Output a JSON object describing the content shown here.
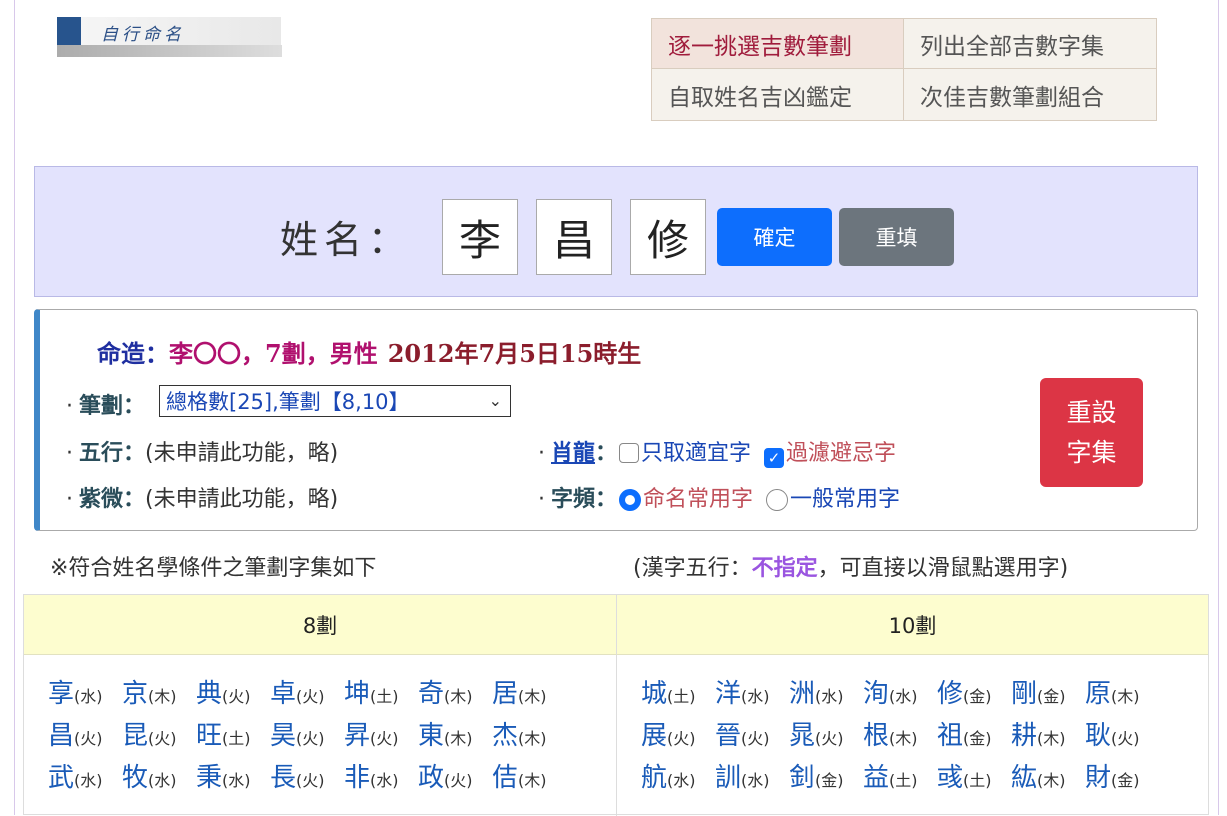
{
  "logo": {
    "text": "自行命名"
  },
  "menu": [
    {
      "label": "逐一挑選吉數筆劃",
      "active": true
    },
    {
      "label": "列出全部吉數字集",
      "active": false
    },
    {
      "label": "自取姓名吉凶鑑定",
      "active": false
    },
    {
      "label": "次佳吉數筆劃組合",
      "active": false
    }
  ],
  "name_form": {
    "label": "姓名：",
    "chars": [
      "李",
      "昌",
      "修"
    ],
    "confirm_label": "確定",
    "reset_label": "重填"
  },
  "fate": {
    "prefix": "命造：",
    "main": "李〇〇，7劃，男性",
    "birth": "2012年7月5日15時生"
  },
  "options": {
    "strokes_label": "筆劃：",
    "strokes_value": "總格數[25],筆劃【8,10】",
    "wuxing_label": "五行：",
    "wuxing_value": "(未申請此功能，略)",
    "ziwei_label": "紫微：",
    "ziwei_value": "(未申請此功能，略)",
    "zodiac_label": "肖龍",
    "zodiac_colon": "：",
    "only_suitable": "只取適宜字",
    "only_suitable_checked": false,
    "filter_taboo": "過濾避忌字",
    "filter_taboo_checked": true,
    "freq_label": "字頻：",
    "freq_common_name": "命名常用字",
    "freq_common_name_selected": true,
    "freq_general": "一般常用字",
    "freq_general_selected": false,
    "reset_set_line1": "重設",
    "reset_set_line2": "字集"
  },
  "notes": {
    "left": "※符合姓名學條件之筆劃字集如下",
    "right_prefix": "(漢字五行：",
    "right_em": "不指定",
    "right_suffix": "，可直接以滑鼠點選用字)"
  },
  "table": {
    "col1_header": "8劃",
    "col2_header": "10劃",
    "col1_chars": [
      [
        "享",
        "水"
      ],
      [
        "京",
        "木"
      ],
      [
        "典",
        "火"
      ],
      [
        "卓",
        "火"
      ],
      [
        "坤",
        "土"
      ],
      [
        "奇",
        "木"
      ],
      [
        "居",
        "木"
      ],
      [
        "昌",
        "火"
      ],
      [
        "昆",
        "火"
      ],
      [
        "旺",
        "土"
      ],
      [
        "昊",
        "火"
      ],
      [
        "昇",
        "火"
      ],
      [
        "東",
        "木"
      ],
      [
        "杰",
        "木"
      ],
      [
        "武",
        "水"
      ],
      [
        "牧",
        "水"
      ],
      [
        "秉",
        "水"
      ],
      [
        "長",
        "火"
      ],
      [
        "非",
        "水"
      ],
      [
        "政",
        "火"
      ],
      [
        "佶",
        "木"
      ]
    ],
    "col2_chars": [
      [
        "城",
        "土"
      ],
      [
        "洋",
        "水"
      ],
      [
        "洲",
        "水"
      ],
      [
        "洵",
        "水"
      ],
      [
        "修",
        "金"
      ],
      [
        "剛",
        "金"
      ],
      [
        "原",
        "木"
      ],
      [
        "展",
        "火"
      ],
      [
        "晉",
        "火"
      ],
      [
        "晁",
        "火"
      ],
      [
        "根",
        "木"
      ],
      [
        "祖",
        "金"
      ],
      [
        "耕",
        "木"
      ],
      [
        "耿",
        "火"
      ],
      [
        "航",
        "水"
      ],
      [
        "訓",
        "水"
      ],
      [
        "釗",
        "金"
      ],
      [
        "益",
        "土"
      ],
      [
        "彧",
        "土"
      ],
      [
        "紘",
        "木"
      ],
      [
        "財",
        "金"
      ]
    ]
  }
}
